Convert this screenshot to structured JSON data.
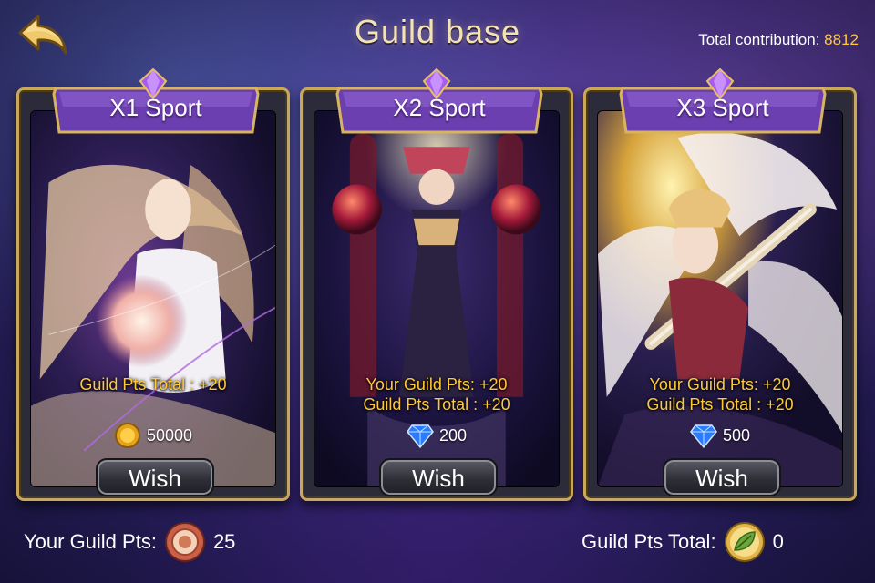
{
  "header": {
    "title": "Guild base",
    "total_contribution_label": "Total contribution:",
    "total_contribution_value": "8812"
  },
  "cards": [
    {
      "title": "X1 Sport",
      "line1": "",
      "line2": "Guild Pts Total : +20",
      "cost": "50000",
      "cost_icon": "gold-coin-icon",
      "button": "Wish"
    },
    {
      "title": "X2 Sport",
      "line1": "Your Guild Pts: +20",
      "line2": "Guild Pts Total : +20",
      "cost": "200",
      "cost_icon": "diamond-icon",
      "button": "Wish"
    },
    {
      "title": "X3 Sport",
      "line1": "Your Guild Pts: +20",
      "line2": "Guild Pts Total : +20",
      "cost": "500",
      "cost_icon": "diamond-icon",
      "button": "Wish"
    }
  ],
  "footer": {
    "your_pts_label": "Your Guild Pts:",
    "your_pts_value": "25",
    "total_label": "Guild Pts Total:",
    "total_value": "0"
  },
  "colors": {
    "accent_gold": "#ffc93a",
    "title_text": "#f3e3b0",
    "banner_purple": "#6b3fb0",
    "frame_gold": "#c9a85a"
  }
}
